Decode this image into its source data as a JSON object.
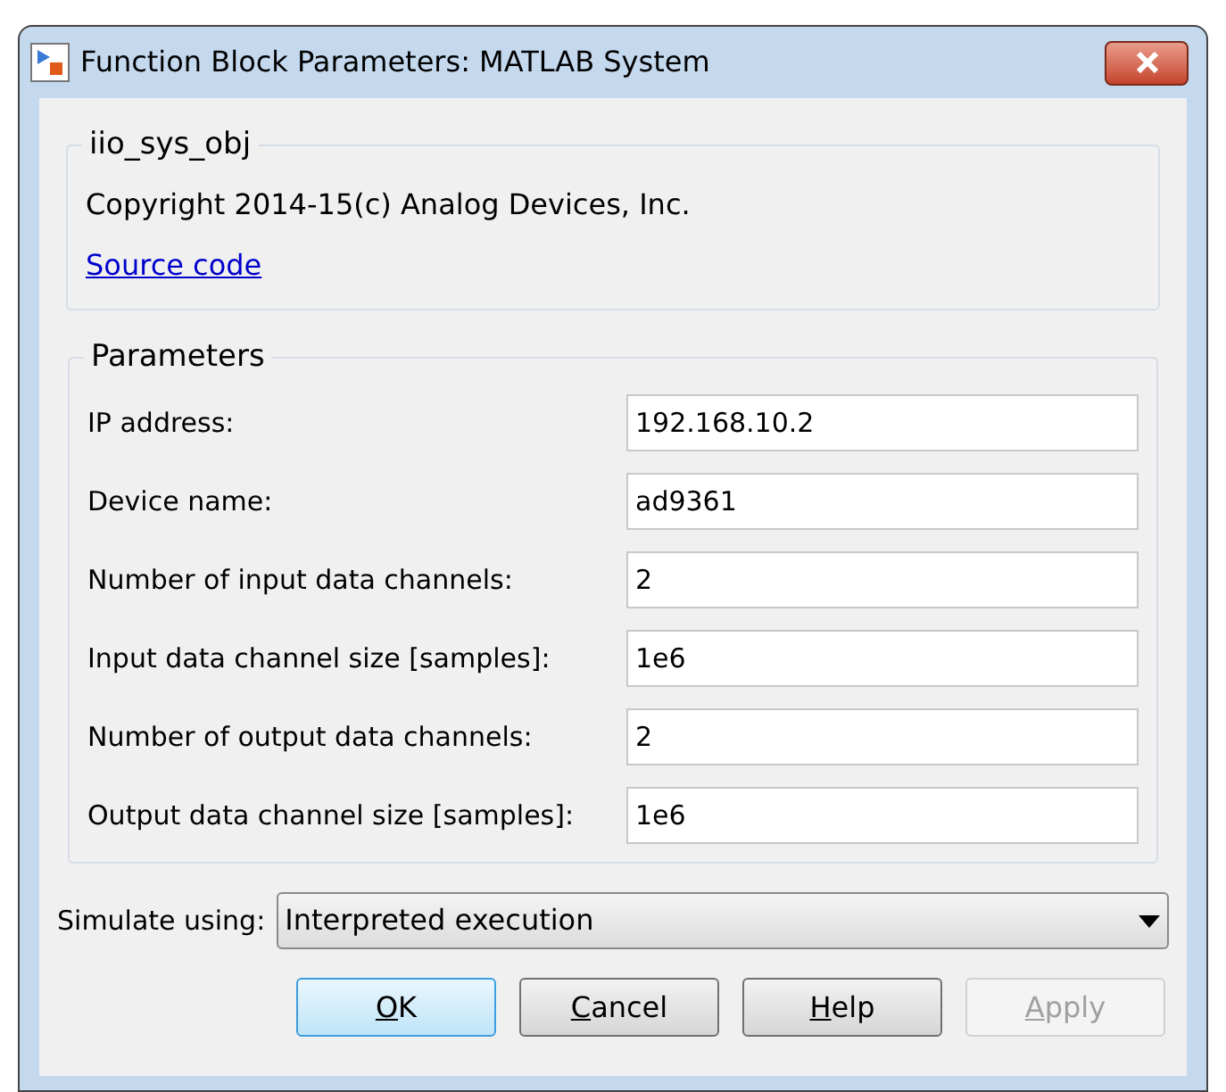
{
  "window": {
    "title": "Function Block Parameters: MATLAB System"
  },
  "description": {
    "title": "iio_sys_obj",
    "text": "Copyright 2014-15(c) Analog Devices, Inc.",
    "link": "Source code"
  },
  "parameters": {
    "title": "Parameters",
    "fields": [
      {
        "label": "IP address:",
        "value": "192.168.10.2"
      },
      {
        "label": "Device name:",
        "value": "ad9361"
      },
      {
        "label": "Number of input data channels:",
        "value": "2"
      },
      {
        "label": "Input data channel size [samples]:",
        "value": "1e6"
      },
      {
        "label": "Number of output data channels:",
        "value": "2"
      },
      {
        "label": "Output data channel size [samples]:",
        "value": "1e6"
      }
    ]
  },
  "simulate": {
    "label": "Simulate using:",
    "value": "Interpreted execution"
  },
  "buttons": [
    {
      "mnemonic": "O",
      "rest": "K",
      "default": true,
      "disabled": false
    },
    {
      "mnemonic": "C",
      "rest": "ancel",
      "default": false,
      "disabled": false
    },
    {
      "mnemonic": "H",
      "rest": "elp",
      "default": false,
      "disabled": false
    },
    {
      "mnemonic": "A",
      "rest": "pply",
      "default": false,
      "disabled": true
    }
  ]
}
